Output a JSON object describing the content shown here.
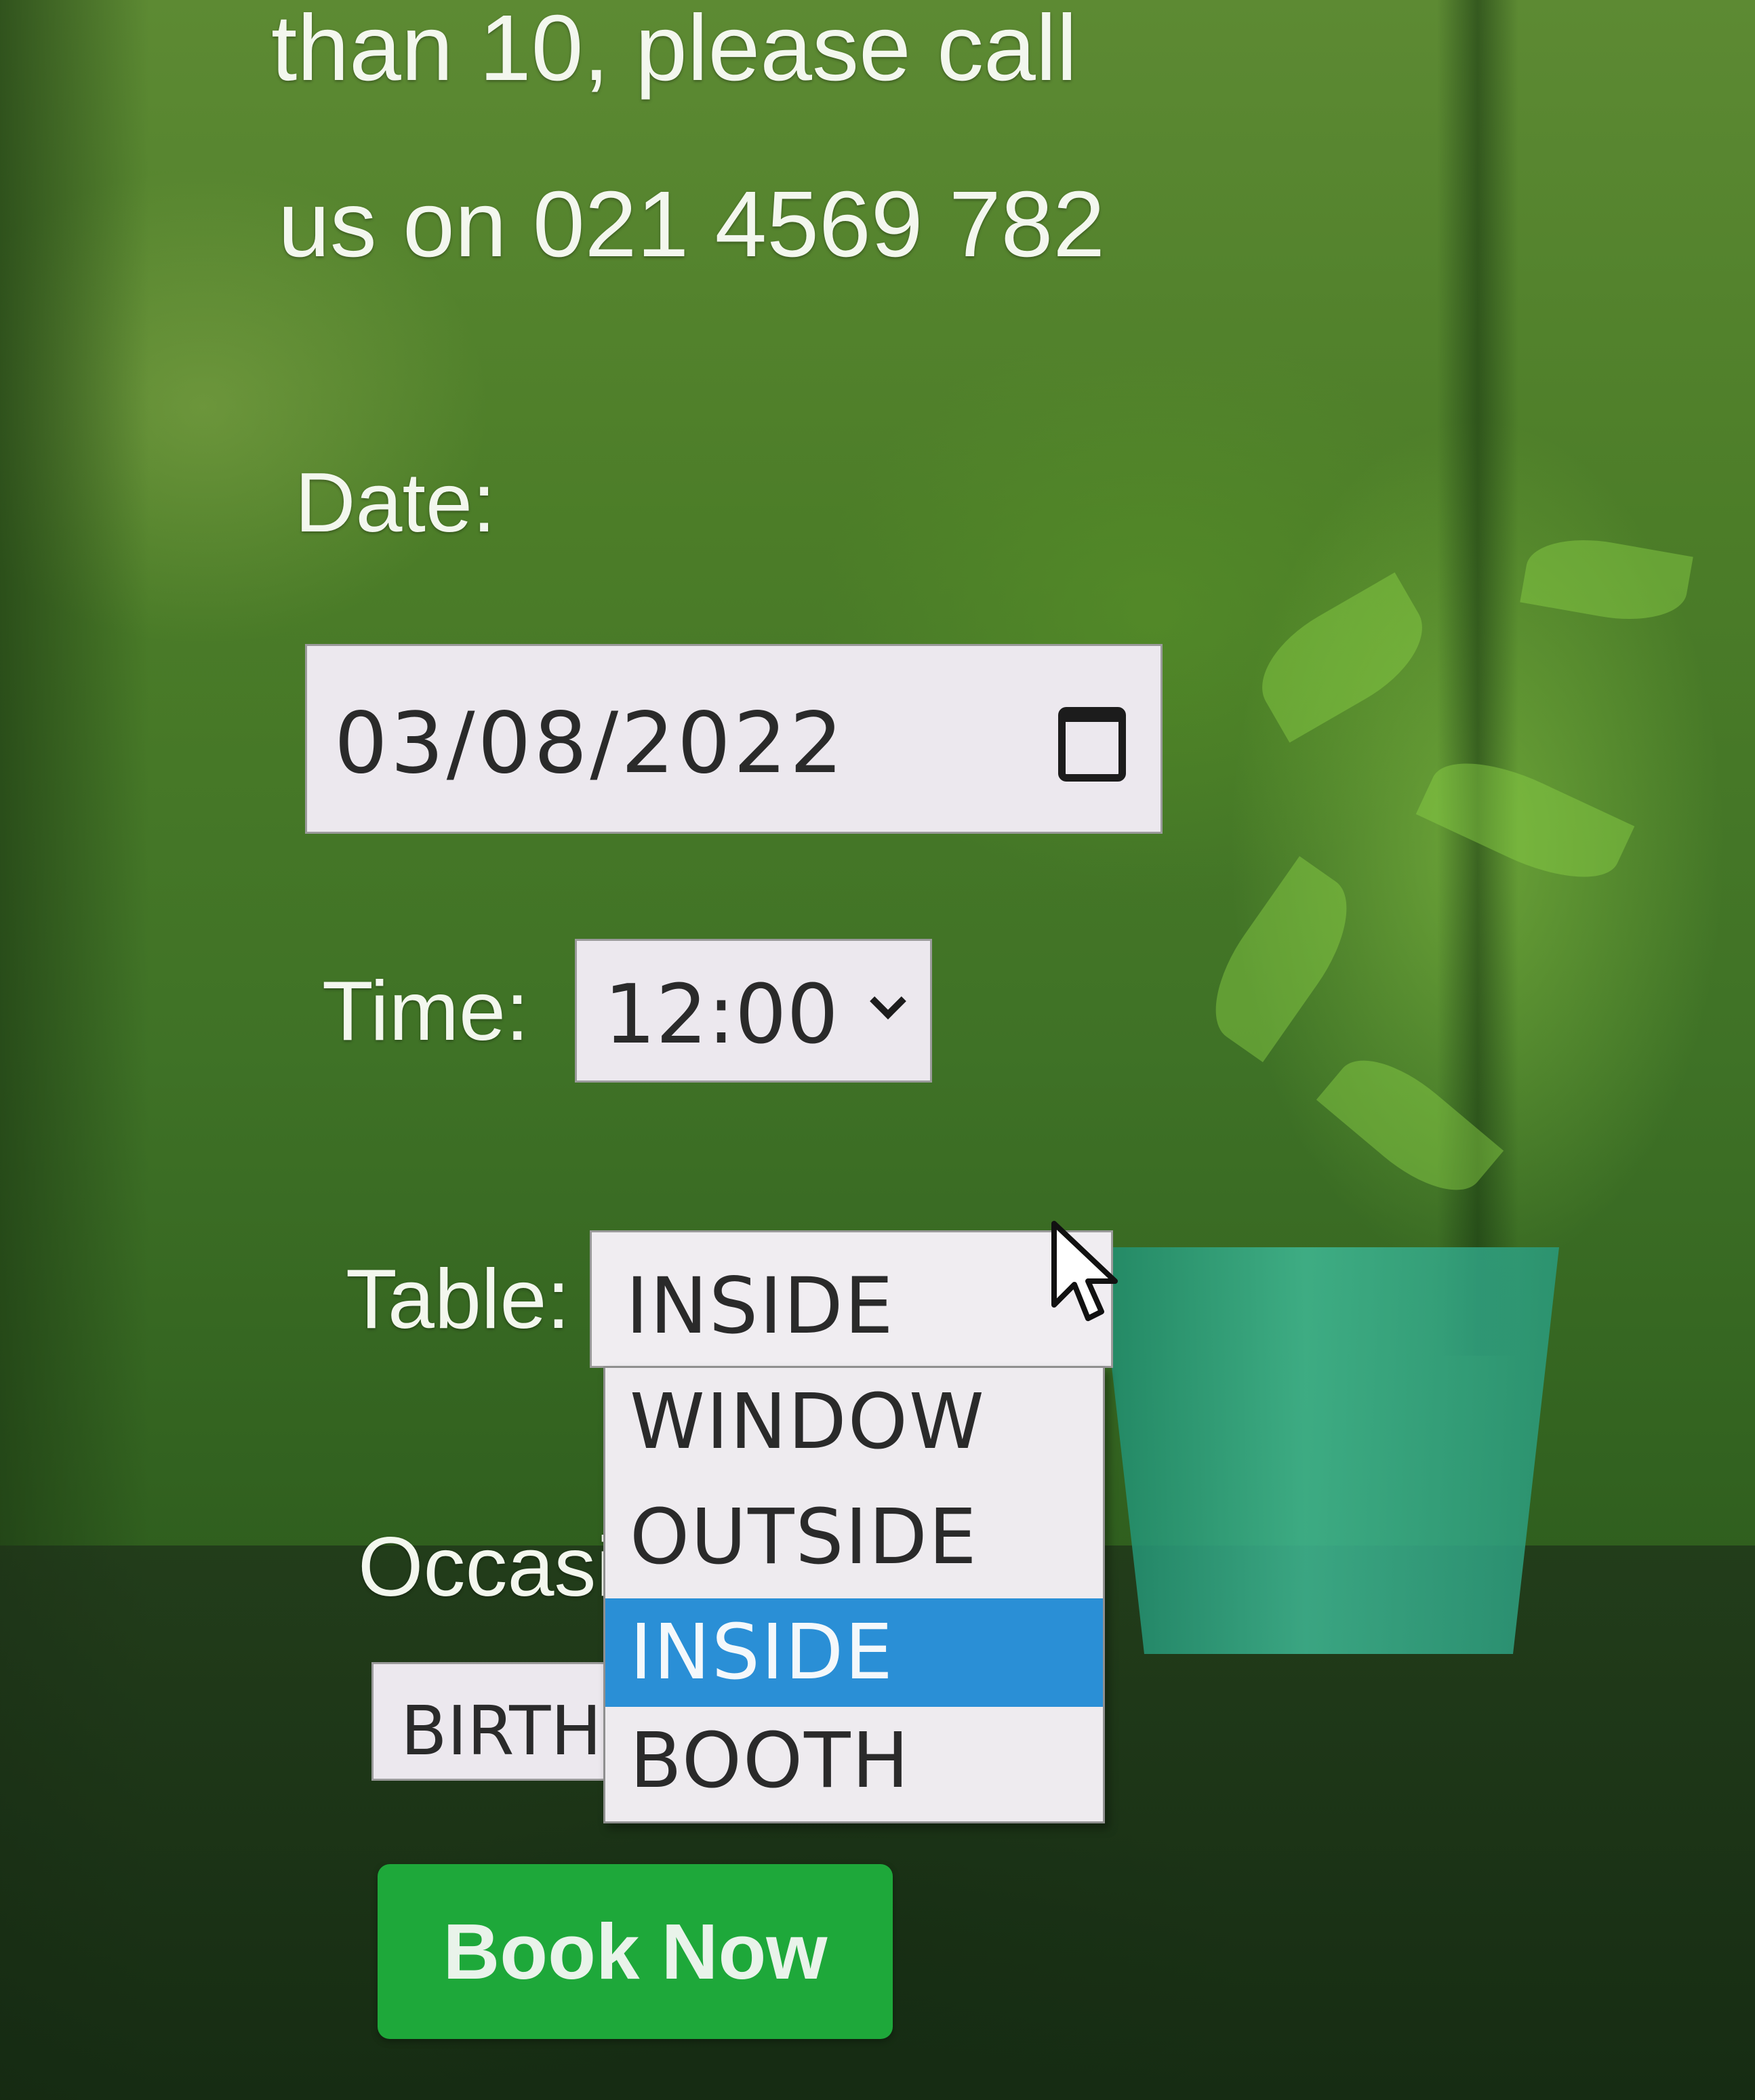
{
  "intro": {
    "line1": "than 10, please call",
    "line2": "us on 021 4569 782"
  },
  "date": {
    "label": "Date:",
    "value": "03/08/2022",
    "icon": "calendar-icon"
  },
  "time": {
    "label": "Time:",
    "value": "12:00",
    "icon": "chevron-down-icon"
  },
  "table": {
    "label": "Table:",
    "value": "INSIDE",
    "options": [
      "WINDOW",
      "OUTSIDE",
      "INSIDE",
      "BOOTH"
    ],
    "highlighted_option": "INSIDE"
  },
  "occasion": {
    "label_visible": "Occasi",
    "value_visible": "BIRTH"
  },
  "book_button": {
    "label": "Book Now"
  },
  "colors": {
    "button_green": "#1ea83a",
    "highlight_blue": "#2a8fd6",
    "label_text": "#f3f7ee"
  }
}
